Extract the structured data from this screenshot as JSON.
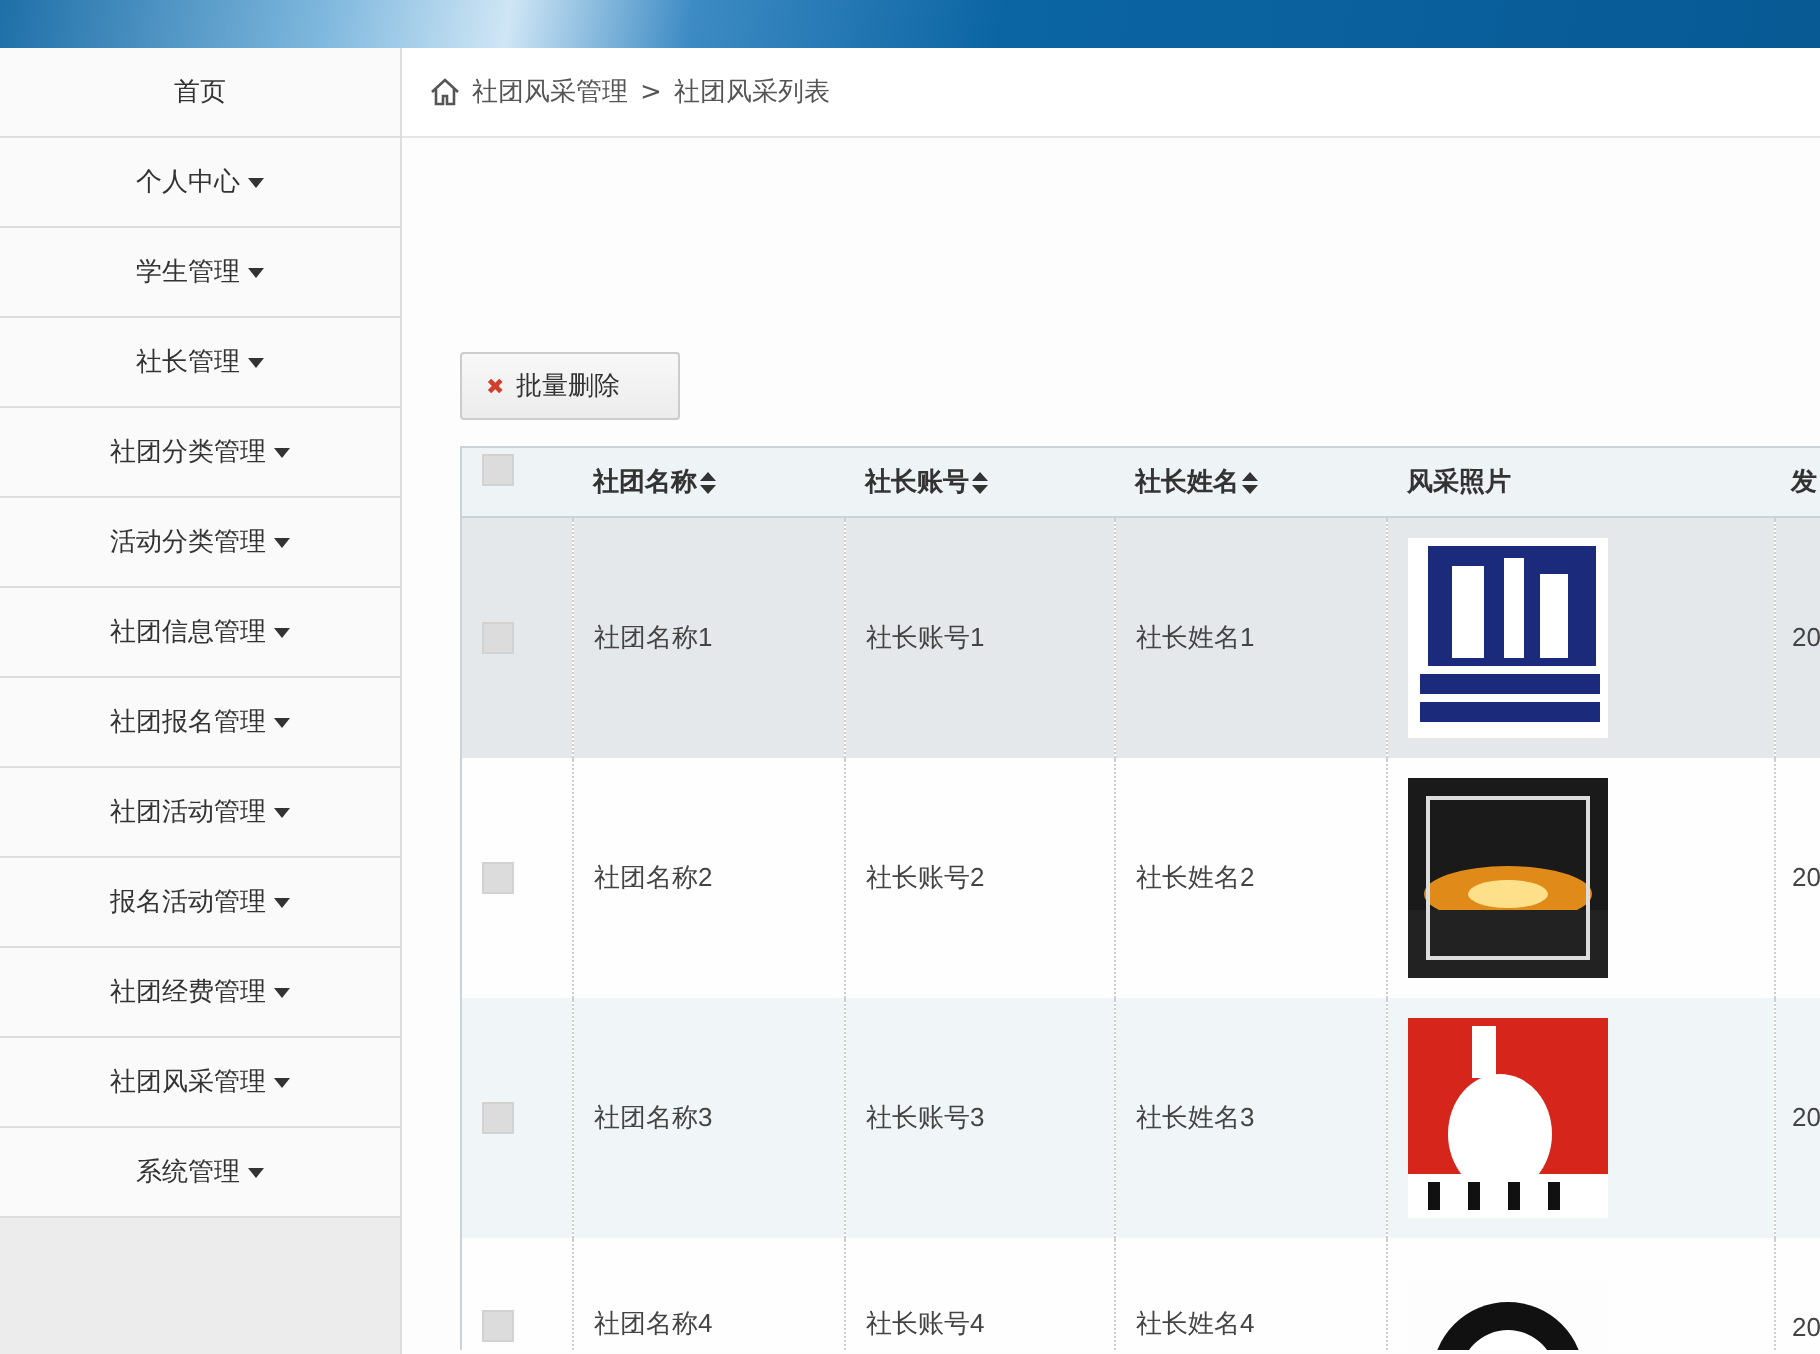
{
  "sidebar": {
    "items": [
      {
        "label": "首页",
        "has_menu": false
      },
      {
        "label": "个人中心",
        "has_menu": true
      },
      {
        "label": "学生管理",
        "has_menu": true
      },
      {
        "label": "社长管理",
        "has_menu": true
      },
      {
        "label": "社团分类管理",
        "has_menu": true
      },
      {
        "label": "活动分类管理",
        "has_menu": true
      },
      {
        "label": "社团信息管理",
        "has_menu": true
      },
      {
        "label": "社团报名管理",
        "has_menu": true
      },
      {
        "label": "社团活动管理",
        "has_menu": true
      },
      {
        "label": "报名活动管理",
        "has_menu": true
      },
      {
        "label": "社团经费管理",
        "has_menu": true
      },
      {
        "label": "社团风采管理",
        "has_menu": true
      },
      {
        "label": "系统管理",
        "has_menu": true
      }
    ]
  },
  "breadcrumb": [
    "社团风采管理",
    ">",
    "社团风采列表"
  ],
  "toolbar": {
    "delete_button": {
      "icon": "✖",
      "label": "批量删除"
    }
  },
  "table": {
    "select_all": {
      "checked": false
    },
    "columns": [
      {
        "label": "社团名称",
        "sortable": true
      },
      {
        "label": "社长账号",
        "sortable": true
      },
      {
        "label": "社长姓名",
        "sortable": true
      },
      {
        "label": "风采照片",
        "sortable": false
      },
      {
        "label": "发"
      }
    ],
    "rows": [
      {
        "checked": false,
        "highlighted": true,
        "cells": [
          "社团名称1",
          "社长账号1",
          "社长姓名1"
        ],
        "photo": {
          "kind": "picture"
        },
        "column_5": "20"
      },
      {
        "checked": false,
        "highlighted": false,
        "cells": [
          "社团名称2",
          "社长账号2",
          "社长姓名2"
        ],
        "photo": {
          "kind": "picture"
        },
        "column_5": "20"
      },
      {
        "checked": false,
        "highlighted": false,
        "cells": [
          "社团名称3",
          "社长账号3",
          "社长姓名3"
        ],
        "photo": {
          "kind": "picture"
        },
        "column_5": "20"
      },
      {
        "checked": false,
        "highlighted": false,
        "cells": [
          "社团名称4",
          "社长账号4",
          "社长姓名4"
        ],
        "photo": {
          "kind": "picture"
        },
        "column_5": "20"
      }
    ]
  }
}
